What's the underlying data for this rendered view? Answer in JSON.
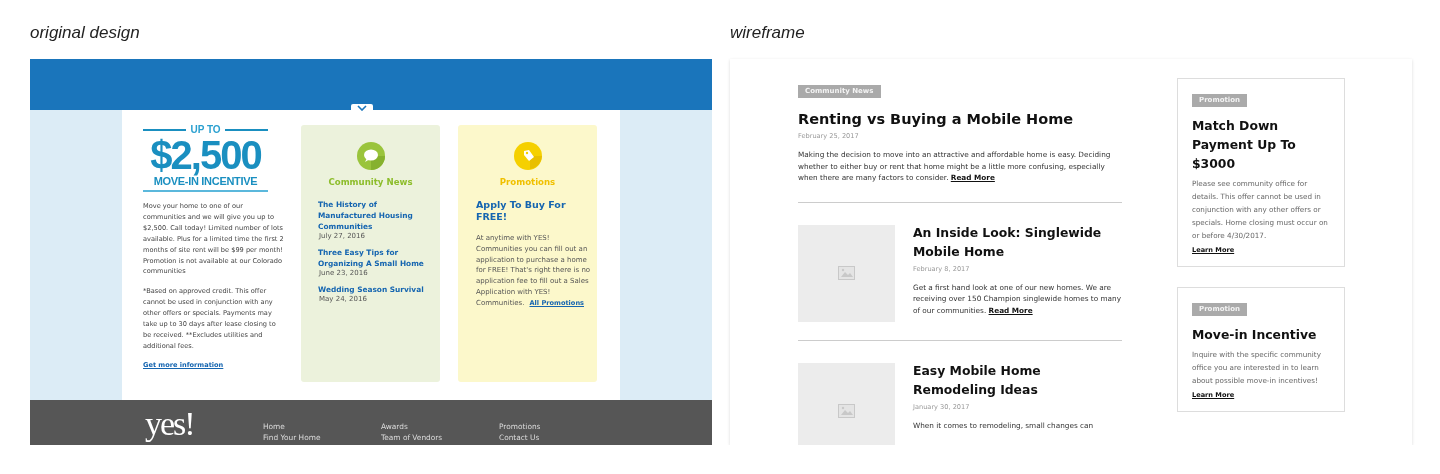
{
  "labels": {
    "original": "original design",
    "wireframe": "wireframe"
  },
  "design": {
    "incentive": {
      "eyebrow": "UP TO",
      "amount": "$2,500",
      "caption": "MOVE-IN INCENTIVE",
      "paragraphs": [
        "Move your home to one of our communities and we will give you up to $2,500. Call today! Limited number of lots available. Plus for a limited time the first 2 months of site rent will be $99 per month! Promotion is not available at our Colorado communities",
        "*Based on approved credit. This offer cannot be used in conjunction with any other offers or specials. Payments may take up to 30 days after lease closing to be received. **Excludes utilities and additional fees."
      ],
      "link": "Get more information"
    },
    "news": {
      "title": "Community News",
      "articles": [
        {
          "title": "The History of Manufactured Housing Communities",
          "date": "July 27, 2016"
        },
        {
          "title": "Three Easy Tips for Organizing A Small Home",
          "date": "June 23, 2016"
        },
        {
          "title": "Wedding Season Survival",
          "date": "May 24, 2016"
        }
      ]
    },
    "promotions": {
      "title": "Promotions",
      "headline": "Apply To Buy For FREE!",
      "body": "At anytime with YES! Communities you can fill out an application to purchase a home for FREE! That's right there is no application fee to fill out a Sales Application with YES! Communities.",
      "link": "All Promotions"
    },
    "footer": {
      "logo": "yes!",
      "columns": [
        [
          "Home",
          "Find Your Home"
        ],
        [
          "Awards",
          "Team of Vendors"
        ],
        [
          "Promotions",
          "Contact Us"
        ]
      ]
    }
  },
  "wireframe": {
    "featured": {
      "tag": "Community News",
      "title": "Renting vs Buying a Mobile Home",
      "date": "February 25, 2017",
      "body": "Making the decision to move into an attractive and affordable home is easy. Deciding whether to either buy or rent that home might be a little more confusing, especially when there are many factors to consider.",
      "link": "Read More"
    },
    "articles": [
      {
        "title": "An Inside Look: Singlewide Mobile Home",
        "date": "February 8, 2017",
        "body": "Get a first hand look at one of our new homes. We are receiving over 150 Champion singlewide homes to many of our communities.",
        "link": "Read More"
      },
      {
        "title": "Easy Mobile Home Remodeling Ideas",
        "date": "January 30, 2017",
        "body": "When it comes to remodeling, small changes can"
      }
    ],
    "promotions": [
      {
        "tag": "Promotion",
        "title": "Match Down Payment Up To $3000",
        "body": "Please see community office for details. This offer cannot be used in conjunction with any other offers or specials. Home closing must occur on or before 4/30/2017.",
        "link": "Learn More"
      },
      {
        "tag": "Promotion",
        "title": "Move-in Incentive",
        "body": "Inquire with the specific community office you are interested in to learn about possible move-in incentives!",
        "link": "Learn More"
      }
    ]
  }
}
